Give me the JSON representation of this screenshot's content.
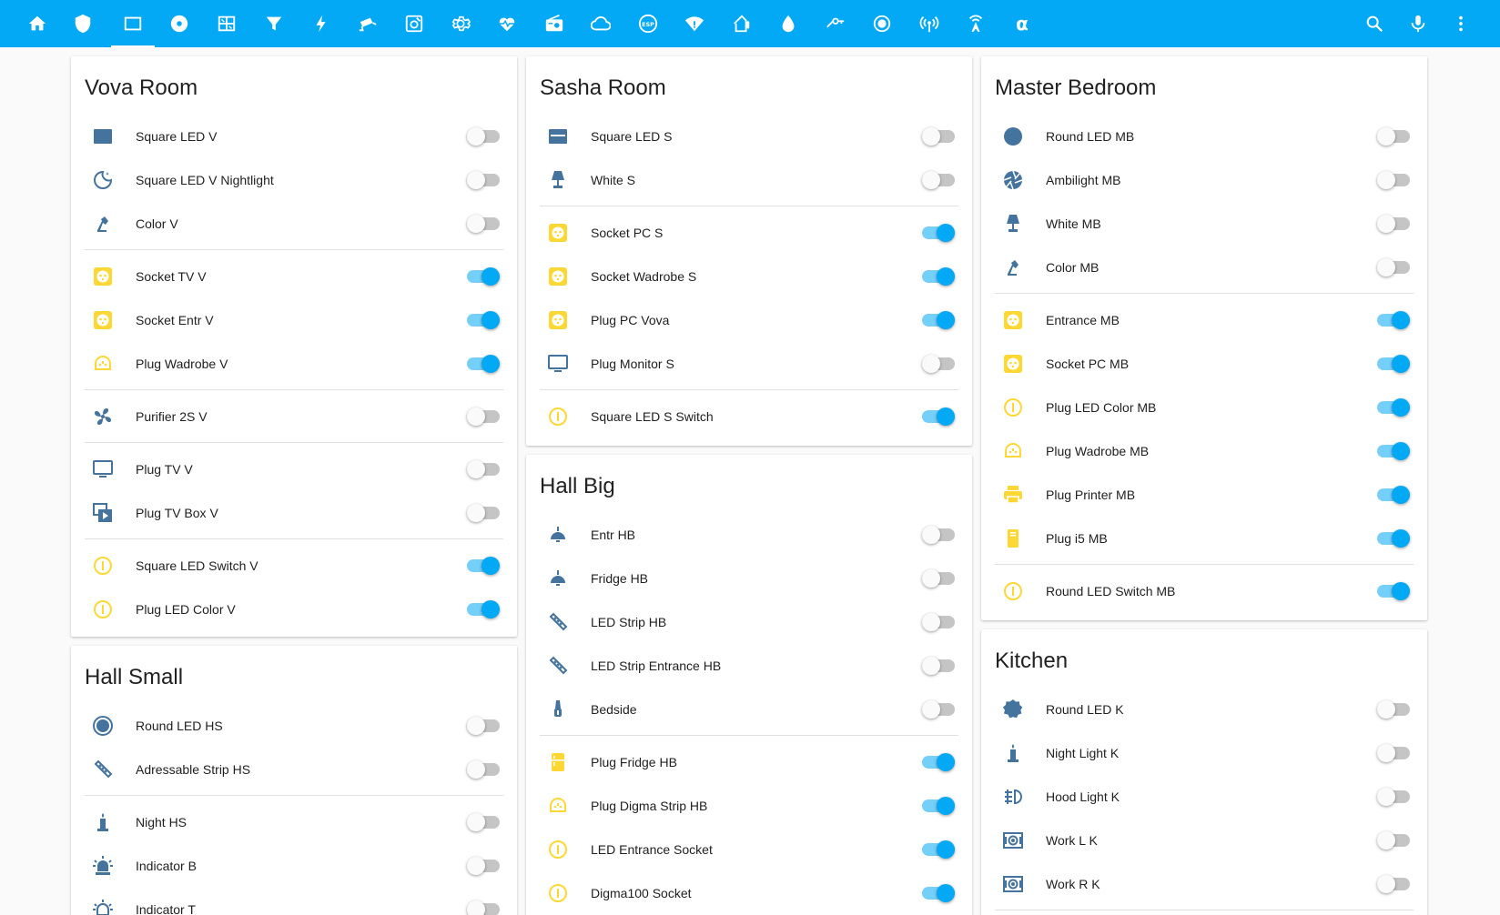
{
  "toolbar": {
    "alpha_label": "α",
    "esp_label": "ESP",
    "background": "#03a9f4"
  },
  "colors": {
    "icon_off": "#44739e",
    "icon_on": "#fdd835",
    "toggle_on": "#03a9f4"
  },
  "cards": {
    "vova": {
      "title": "Vova Room",
      "items": [
        {
          "name": "Square LED V",
          "on": false
        },
        {
          "name": "Square LED V Nightlight",
          "on": false
        },
        {
          "name": "Color V",
          "on": false
        },
        {
          "name": "Socket TV V",
          "on": true
        },
        {
          "name": "Socket Entr V",
          "on": true
        },
        {
          "name": "Plug Wadrobe V",
          "on": true
        },
        {
          "name": "Purifier 2S V",
          "on": false
        },
        {
          "name": "Plug TV V",
          "on": false
        },
        {
          "name": "Plug TV Box V",
          "on": false
        },
        {
          "name": "Square LED Switch V",
          "on": true
        },
        {
          "name": "Plug LED Color V",
          "on": true
        }
      ]
    },
    "hall_small": {
      "title": "Hall Small",
      "items": [
        {
          "name": "Round LED HS",
          "on": false
        },
        {
          "name": "Adressable Strip HS",
          "on": false
        },
        {
          "name": "Night HS",
          "on": false
        },
        {
          "name": "Indicator B",
          "on": false
        },
        {
          "name": "Indicator T",
          "on": false
        }
      ]
    },
    "sasha": {
      "title": "Sasha Room",
      "items": [
        {
          "name": "Square LED S",
          "on": false
        },
        {
          "name": "White S",
          "on": false
        },
        {
          "name": "Socket PC S",
          "on": true
        },
        {
          "name": "Socket Wadrobe S",
          "on": true
        },
        {
          "name": "Plug PC Vova",
          "on": true
        },
        {
          "name": "Plug Monitor S",
          "on": false
        },
        {
          "name": "Square LED S Switch",
          "on": true
        }
      ]
    },
    "hall_big": {
      "title": "Hall Big",
      "items": [
        {
          "name": "Entr HB",
          "on": false
        },
        {
          "name": "Fridge HB",
          "on": false
        },
        {
          "name": "LED Strip HB",
          "on": false
        },
        {
          "name": "LED Strip Entrance HB",
          "on": false
        },
        {
          "name": "Bedside",
          "on": false
        },
        {
          "name": "Plug Fridge HB",
          "on": true
        },
        {
          "name": "Plug Digma Strip HB",
          "on": true
        },
        {
          "name": "LED Entrance Socket",
          "on": true
        },
        {
          "name": "Digma100 Socket",
          "on": true
        }
      ]
    },
    "master": {
      "title": "Master Bedroom",
      "items": [
        {
          "name": "Round LED MB",
          "on": false
        },
        {
          "name": "Ambilight MB",
          "on": false
        },
        {
          "name": "White MB",
          "on": false
        },
        {
          "name": "Color MB",
          "on": false
        },
        {
          "name": "Entrance MB",
          "on": true
        },
        {
          "name": "Socket PC MB",
          "on": true
        },
        {
          "name": "Plug LED Color MB",
          "on": true
        },
        {
          "name": "Plug Wadrobe MB",
          "on": true
        },
        {
          "name": "Plug Printer MB",
          "on": true
        },
        {
          "name": "Plug i5 MB",
          "on": true
        },
        {
          "name": "Round LED Switch MB",
          "on": true
        }
      ]
    },
    "kitchen": {
      "title": "Kitchen",
      "items": [
        {
          "name": "Round LED K",
          "on": false
        },
        {
          "name": "Night Light K",
          "on": false
        },
        {
          "name": "Hood Light K",
          "on": false
        },
        {
          "name": "Work L K",
          "on": false
        },
        {
          "name": "Work R K",
          "on": false
        }
      ]
    }
  }
}
